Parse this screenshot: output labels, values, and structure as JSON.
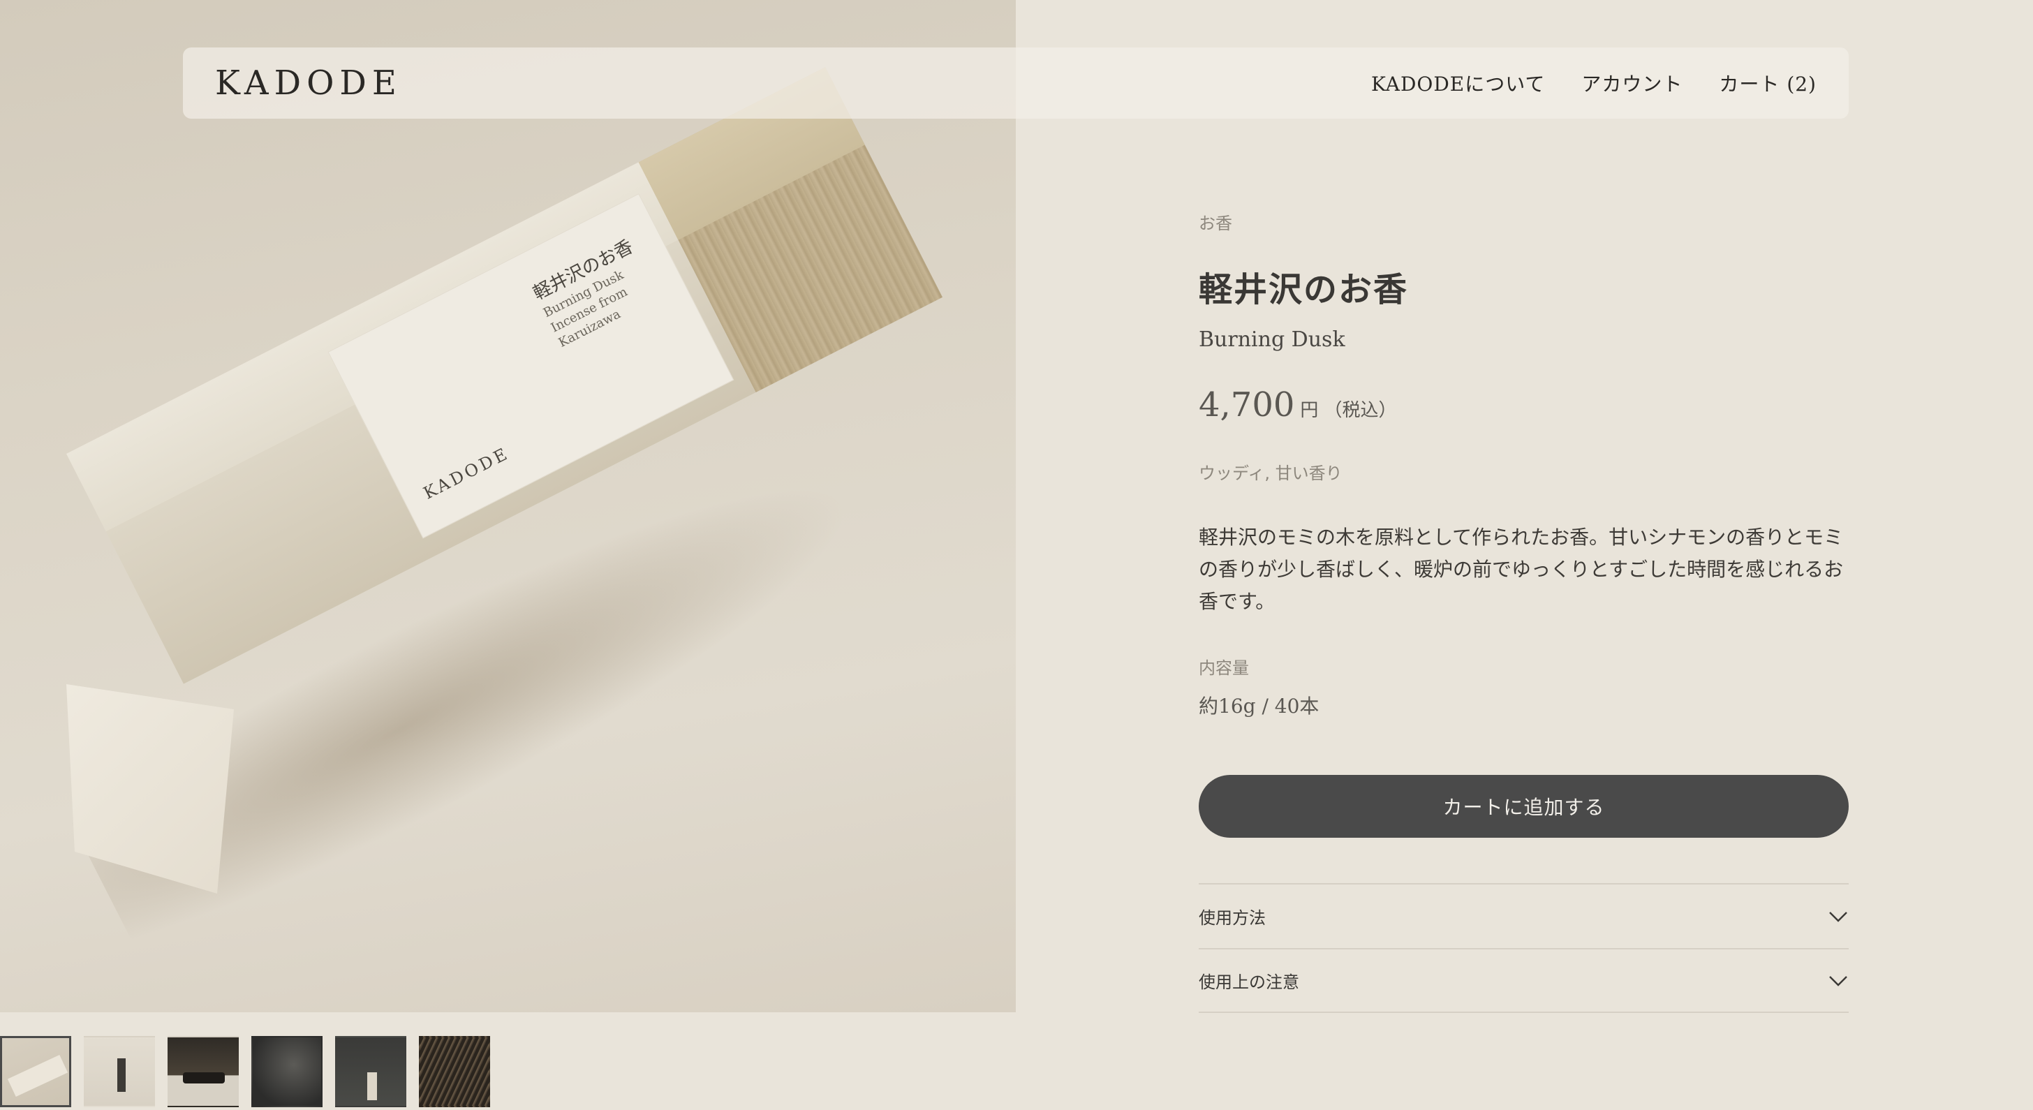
{
  "header": {
    "logo": "KADODE",
    "nav": {
      "about": "KADODEについて",
      "account": "アカウント",
      "cart": "カート (2)"
    }
  },
  "product": {
    "category": "お香",
    "title": "軽井沢のお香",
    "subtitle": "Burning Dusk",
    "price": "4,700",
    "price_unit": "円",
    "price_tax": "（税込）",
    "tags": "ウッディ, 甘い香り",
    "description": "軽井沢のモミの木を原料として作られたお香。甘いシナモンの香りとモミの香りが少し香ばしく、暖炉の前でゆっくりとすごした時間を感じれるお香です。",
    "spec_label": "内容量",
    "spec_value": "約16g / 40本",
    "add_to_cart": "カートに追加する"
  },
  "box_label": {
    "jp": "軽井沢のお香",
    "en_line1": "Burning Dusk",
    "en_line2": "Incense from Karuizawa",
    "brand": "KADODE"
  },
  "accordion": [
    {
      "label": "使用方法",
      "icon": "chevron-down-icon"
    },
    {
      "label": "使用上の注意",
      "icon": "chevron-down-icon"
    }
  ],
  "thumbnails": [
    {
      "name": "thumbnail-1",
      "active": true
    },
    {
      "name": "thumbnail-2",
      "active": false
    },
    {
      "name": "thumbnail-3",
      "active": false
    },
    {
      "name": "thumbnail-4",
      "active": false
    },
    {
      "name": "thumbnail-5",
      "active": false
    },
    {
      "name": "thumbnail-6",
      "active": false
    }
  ],
  "colors": {
    "background": "#e9e4da",
    "button": "#4a4a4a",
    "text": "#3a3835",
    "muted": "#8d877d"
  }
}
